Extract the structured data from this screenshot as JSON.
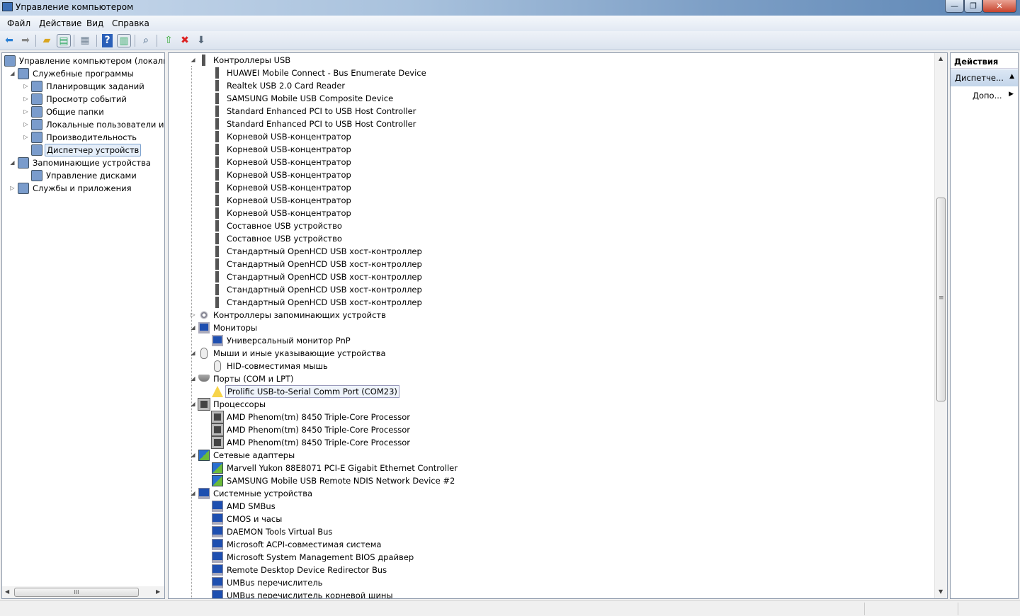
{
  "window": {
    "title": "Управление компьютером",
    "minimize": "—",
    "maximize": "❐",
    "close": "✕"
  },
  "menu": [
    "Файл",
    "Действие",
    "Вид",
    "Справка"
  ],
  "toolbar": [
    "back-icon",
    "forward-icon",
    "up-folder-icon",
    "show-hide-tree-icon",
    "properties-icon",
    "help-icon",
    "show-action-pane-icon",
    "scan-hardware-icon",
    "update-driver-icon",
    "uninstall-icon",
    "disable-icon"
  ],
  "left_tree": [
    {
      "label": "Управление компьютером (локальны",
      "level": 0,
      "exp": "",
      "icon": "computer-management-icon"
    },
    {
      "label": "Служебные программы",
      "level": 1,
      "exp": "open",
      "icon": "tools-icon"
    },
    {
      "label": "Планировщик заданий",
      "level": 2,
      "exp": "closed",
      "icon": "clock-icon"
    },
    {
      "label": "Просмотр событий",
      "level": 2,
      "exp": "closed",
      "icon": "event-viewer-icon"
    },
    {
      "label": "Общие папки",
      "level": 2,
      "exp": "closed",
      "icon": "shared-folder-icon"
    },
    {
      "label": "Локальные пользователи и гр",
      "level": 2,
      "exp": "closed",
      "icon": "users-icon"
    },
    {
      "label": "Производительность",
      "level": 2,
      "exp": "closed",
      "icon": "performance-icon"
    },
    {
      "label": "Диспетчер устройств",
      "level": 2,
      "exp": "",
      "icon": "device-manager-icon",
      "selected": true
    },
    {
      "label": "Запоминающие устройства",
      "level": 1,
      "exp": "open",
      "icon": "storage-icon"
    },
    {
      "label": "Управление дисками",
      "level": 2,
      "exp": "",
      "icon": "disk-icon"
    },
    {
      "label": "Службы и приложения",
      "level": 1,
      "exp": "closed",
      "icon": "services-icon"
    }
  ],
  "device_tree": [
    {
      "label": "Контроллеры USB",
      "level": 0,
      "exp": "open",
      "icon": "usb"
    },
    {
      "label": "HUAWEI Mobile Connect - Bus Enumerate Device",
      "level": 1,
      "icon": "usb"
    },
    {
      "label": "Realtek USB 2.0 Card Reader",
      "level": 1,
      "icon": "usb"
    },
    {
      "label": "SAMSUNG Mobile USB Composite Device",
      "level": 1,
      "icon": "usb"
    },
    {
      "label": "Standard Enhanced PCI to USB Host Controller",
      "level": 1,
      "icon": "usb"
    },
    {
      "label": "Standard Enhanced PCI to USB Host Controller",
      "level": 1,
      "icon": "usb"
    },
    {
      "label": "Корневой USB-концентратор",
      "level": 1,
      "icon": "usb"
    },
    {
      "label": "Корневой USB-концентратор",
      "level": 1,
      "icon": "usb"
    },
    {
      "label": "Корневой USB-концентратор",
      "level": 1,
      "icon": "usb"
    },
    {
      "label": "Корневой USB-концентратор",
      "level": 1,
      "icon": "usb"
    },
    {
      "label": "Корневой USB-концентратор",
      "level": 1,
      "icon": "usb"
    },
    {
      "label": "Корневой USB-концентратор",
      "level": 1,
      "icon": "usb"
    },
    {
      "label": "Корневой USB-концентратор",
      "level": 1,
      "icon": "usb"
    },
    {
      "label": "Составное USB устройство",
      "level": 1,
      "icon": "usb"
    },
    {
      "label": "Составное USB устройство",
      "level": 1,
      "icon": "usb"
    },
    {
      "label": "Стандартный OpenHCD USB хост-контроллер",
      "level": 1,
      "icon": "usb"
    },
    {
      "label": "Стандартный OpenHCD USB хост-контроллер",
      "level": 1,
      "icon": "usb"
    },
    {
      "label": "Стандартный OpenHCD USB хост-контроллер",
      "level": 1,
      "icon": "usb"
    },
    {
      "label": "Стандартный OpenHCD USB хост-контроллер",
      "level": 1,
      "icon": "usb"
    },
    {
      "label": "Стандартный OpenHCD USB хост-контроллер",
      "level": 1,
      "icon": "usb"
    },
    {
      "label": "Контроллеры запоминающих устройств",
      "level": 0,
      "exp": "closed",
      "icon": "storage"
    },
    {
      "label": "Мониторы",
      "level": 0,
      "exp": "open",
      "icon": "monitor"
    },
    {
      "label": "Универсальный монитор PnP",
      "level": 1,
      "icon": "monitor"
    },
    {
      "label": "Мыши и иные указывающие устройства",
      "level": 0,
      "exp": "open",
      "icon": "mouse"
    },
    {
      "label": "HID-совместимая мышь",
      "level": 1,
      "icon": "mouse"
    },
    {
      "label": "Порты (COM и LPT)",
      "level": 0,
      "exp": "open",
      "icon": "port"
    },
    {
      "label": "Prolific USB-to-Serial Comm Port (COM23)",
      "level": 1,
      "icon": "warning",
      "selected": true
    },
    {
      "label": "Процессоры",
      "level": 0,
      "exp": "open",
      "icon": "cpu"
    },
    {
      "label": "AMD Phenom(tm) 8450 Triple-Core Processor",
      "level": 1,
      "icon": "cpu"
    },
    {
      "label": "AMD Phenom(tm) 8450 Triple-Core Processor",
      "level": 1,
      "icon": "cpu"
    },
    {
      "label": "AMD Phenom(tm) 8450 Triple-Core Processor",
      "level": 1,
      "icon": "cpu"
    },
    {
      "label": "Сетевые адаптеры",
      "level": 0,
      "exp": "open",
      "icon": "network"
    },
    {
      "label": "Marvell Yukon 88E8071 PCI-E Gigabit Ethernet Controller",
      "level": 1,
      "icon": "network"
    },
    {
      "label": "SAMSUNG Mobile USB Remote NDIS Network Device #2",
      "level": 1,
      "icon": "network"
    },
    {
      "label": "Системные устройства",
      "level": 0,
      "exp": "open",
      "icon": "system"
    },
    {
      "label": "AMD SMBus",
      "level": 1,
      "icon": "system"
    },
    {
      "label": "CMOS и часы",
      "level": 1,
      "icon": "system"
    },
    {
      "label": "DAEMON Tools Virtual Bus",
      "level": 1,
      "icon": "system"
    },
    {
      "label": "Microsoft ACPI-совместимая система",
      "level": 1,
      "icon": "system"
    },
    {
      "label": "Microsoft System Management BIOS драйвер",
      "level": 1,
      "icon": "system"
    },
    {
      "label": "Remote Desktop Device Redirector Bus",
      "level": 1,
      "icon": "system"
    },
    {
      "label": "UMBus перечислитель",
      "level": 1,
      "icon": "system"
    },
    {
      "label": "UMBus перечислитель корневой шины",
      "level": 1,
      "icon": "system"
    }
  ],
  "actions": {
    "header": "Действия",
    "section": "Диспетче...",
    "more": "Допо..."
  },
  "scrollbar": {
    "grip": "≡",
    "hgrip": "III"
  }
}
